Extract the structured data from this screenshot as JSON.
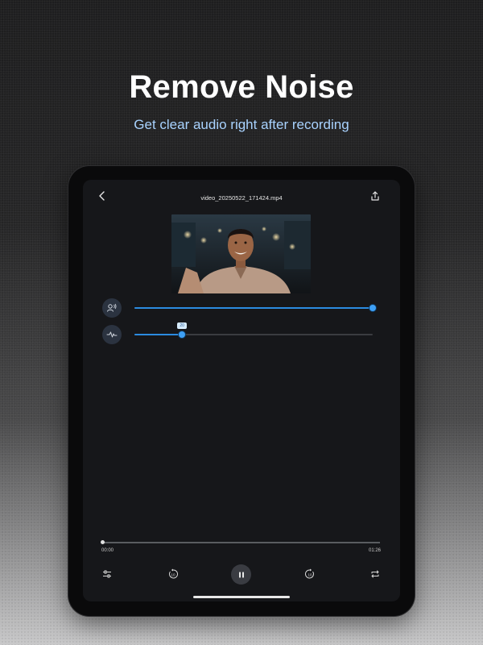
{
  "headline": "Remove Noise",
  "subheadline": "Get clear audio right after recording",
  "player": {
    "file_name": "video_20250522_171424.mp4",
    "voice_slider": {
      "icon": "voice-enhance-icon",
      "level": 1.0
    },
    "noise_slider": {
      "icon": "waveform-icon",
      "level": 0.2,
      "value_label": "20"
    },
    "progress": 0.0,
    "current_time": "00:00",
    "total_time": "01:26",
    "controls": {
      "adjust": "sliders-icon",
      "rewind_seconds": "10",
      "play_state": "pause-icon",
      "forward_seconds": "10",
      "repeat": "repeat-icon"
    }
  },
  "colors": {
    "accent": "#2b8be0",
    "subheadline": "#a9d3ff",
    "screen_bg": "#16171a"
  }
}
